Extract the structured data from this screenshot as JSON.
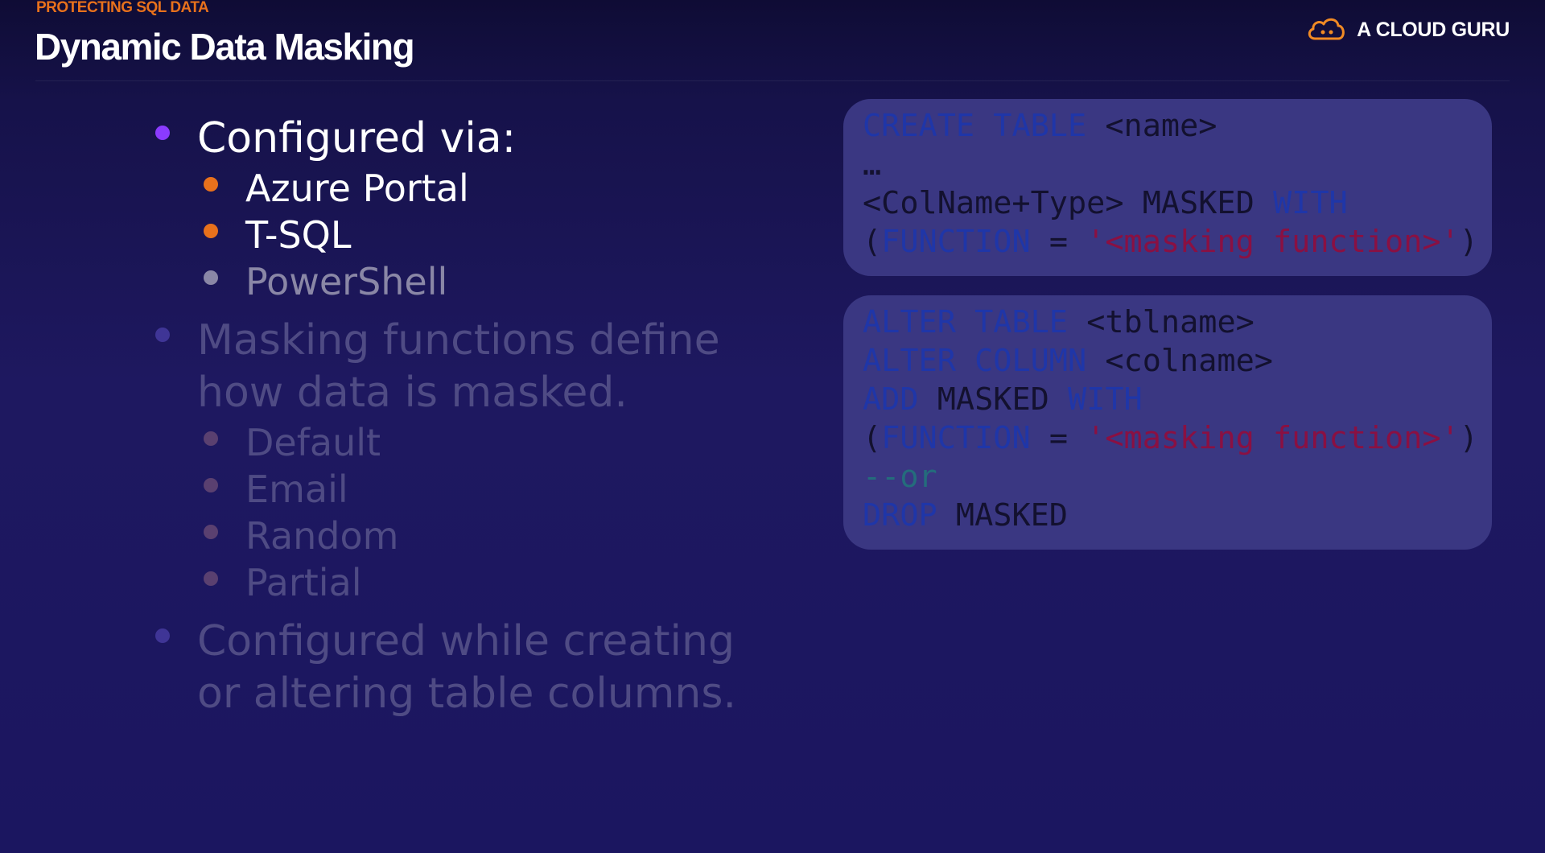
{
  "header": {
    "eyebrow": "PROTECTING SQL DATA",
    "title": "Dynamic Data Masking",
    "brand": "A CLOUD GURU"
  },
  "bullets": {
    "configured_via": {
      "label": "Configured via:",
      "items": [
        "Azure Portal",
        "T-SQL",
        "PowerShell"
      ]
    },
    "masking_functions": {
      "label_line1": "Masking functions define",
      "label_line2": "how data is masked.",
      "items": [
        "Default",
        "Email",
        "Random",
        "Partial"
      ]
    },
    "configured_while": {
      "label_line1": "Configured while creating",
      "label_line2": "or altering table columns."
    }
  },
  "code_create": {
    "kw_create": "CREATE",
    "kw_table": "TABLE",
    "name_placeholder": "<name>",
    "ellipsis": "…",
    "colname_type": "<ColName+Type>",
    "kw_masked": "MASKED",
    "kw_with": "WITH",
    "open_paren": "(",
    "kw_function": "FUNCTION",
    "equals": "=",
    "masking_fn": "'<masking function>'",
    "close_paren": ")"
  },
  "code_alter": {
    "kw_alter": "ALTER",
    "kw_table": "TABLE",
    "tblname": "<tblname>",
    "kw_alter2": "ALTER",
    "kw_column": "COLUMN",
    "colname": "<colname>",
    "kw_add": "ADD",
    "kw_masked": "MASKED",
    "kw_with": "WITH",
    "open_paren": "(",
    "kw_function": "FUNCTION",
    "equals": "=",
    "masking_fn": "'<masking function>'",
    "close_paren": ")",
    "comment": "--or",
    "kw_drop": "DROP",
    "kw_masked2": "MASKED"
  },
  "colors": {
    "eyebrow": "#e8711c",
    "bullet_primary": "#8b3bff",
    "bullet_secondary": "#e8711c",
    "keyword": "#1f36a8",
    "string": "#8a1042",
    "comment": "#246c7c",
    "card_bg": "#3a3782"
  },
  "icons": {
    "brand_logo": "cloud-icon"
  }
}
